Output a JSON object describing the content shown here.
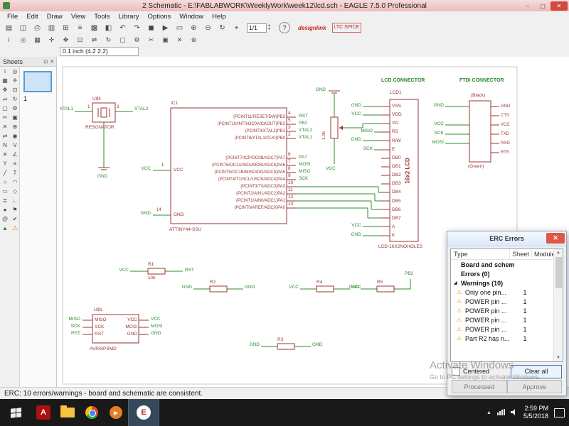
{
  "window": {
    "title": "2 Schematic - E:\\FABLABWORK\\WeeklyWork\\week12\\lcd.sch - EAGLE 7.5.0 Professional",
    "min_glyph": "–",
    "max_glyph": "▢",
    "close_glyph": "✕"
  },
  "menu": {
    "items": [
      "File",
      "Edit",
      "Draw",
      "View",
      "Tools",
      "Library",
      "Options",
      "Window",
      "Help"
    ]
  },
  "toolbar": {
    "zoom": "1/1",
    "coord": "0.1 inch (4.2 2.2)",
    "help": "?",
    "designlink": "designlink",
    "ltspice": "LTC SPICE",
    "row1": [
      {
        "name": "open-folder",
        "glyph": "▤"
      },
      {
        "name": "save",
        "glyph": "◫"
      },
      {
        "name": "print",
        "glyph": "⎙"
      },
      {
        "name": "export-image",
        "glyph": "▥"
      },
      {
        "name": "switch-to-board",
        "glyph": "⊞"
      },
      {
        "name": "use-library",
        "glyph": "≡"
      },
      {
        "name": "grid",
        "glyph": "▩"
      },
      {
        "name": "layer-settings",
        "glyph": "◧"
      },
      {
        "name": "undo",
        "glyph": "↶"
      },
      {
        "name": "redo",
        "glyph": "↷"
      },
      {
        "name": "stop-command",
        "glyph": "◼"
      },
      {
        "name": "run-script",
        "glyph": "▶"
      },
      {
        "name": "zoom-fit",
        "glyph": "▭"
      },
      {
        "name": "zoom-in",
        "glyph": "⊕"
      },
      {
        "name": "zoom-out",
        "glyph": "⊖"
      },
      {
        "name": "zoom-redraw",
        "glyph": "↻"
      },
      {
        "name": "zoom-select",
        "glyph": "⌖"
      }
    ],
    "row2": [
      {
        "name": "info",
        "glyph": "i"
      },
      {
        "name": "show",
        "glyph": "◎"
      },
      {
        "name": "display-layers",
        "glyph": "▦"
      },
      {
        "name": "mark",
        "glyph": "✛"
      },
      {
        "name": "move",
        "glyph": "✥"
      },
      {
        "name": "copy",
        "glyph": "⊡"
      },
      {
        "name": "mirror",
        "glyph": "⇌"
      },
      {
        "name": "rotate",
        "glyph": "↻"
      },
      {
        "name": "group",
        "glyph": "▢"
      },
      {
        "name": "change",
        "glyph": "⚙"
      },
      {
        "name": "cut",
        "glyph": "✂"
      },
      {
        "name": "paste",
        "glyph": "▣"
      },
      {
        "name": "delete",
        "glyph": "✕"
      },
      {
        "name": "add-part",
        "glyph": "⊕"
      }
    ]
  },
  "sheets": {
    "title": "Sheets",
    "selected": "1",
    "pin_icon": "⊡",
    "close_icon": "✕"
  },
  "palette": {
    "icons": [
      {
        "name": "info-tool",
        "glyph": "i"
      },
      {
        "name": "show-tool",
        "glyph": "◎"
      },
      {
        "name": "display-tool",
        "glyph": "▦"
      },
      {
        "name": "mark-tool",
        "glyph": "✛"
      },
      {
        "name": "move-tool",
        "glyph": "✥"
      },
      {
        "name": "copy-tool",
        "glyph": "⊡"
      },
      {
        "name": "mirror-tool",
        "glyph": "⇌"
      },
      {
        "name": "rotate-tool",
        "glyph": "↻"
      },
      {
        "name": "group-tool",
        "glyph": "▢"
      },
      {
        "name": "change-tool",
        "glyph": "⚙"
      },
      {
        "name": "cut-tool",
        "glyph": "✂"
      },
      {
        "name": "paste-tool",
        "glyph": "▣"
      },
      {
        "name": "delete-tool",
        "glyph": "✕"
      },
      {
        "name": "add-tool",
        "glyph": "⊕"
      },
      {
        "name": "pinswap-tool",
        "glyph": "⇄"
      },
      {
        "name": "replace-tool",
        "glyph": "◉"
      },
      {
        "name": "name-tool",
        "glyph": "N"
      },
      {
        "name": "value-tool",
        "glyph": "V"
      },
      {
        "name": "smash-tool",
        "glyph": "✳"
      },
      {
        "name": "miter-tool",
        "glyph": "∠"
      },
      {
        "name": "split-tool",
        "glyph": "Y"
      },
      {
        "name": "invoke-tool",
        "glyph": "≡"
      },
      {
        "name": "wire-tool",
        "glyph": "╱"
      },
      {
        "name": "text-tool",
        "glyph": "T"
      },
      {
        "name": "circle-tool",
        "glyph": "○"
      },
      {
        "name": "arc-tool",
        "glyph": "◠"
      },
      {
        "name": "rect-tool",
        "glyph": "▭"
      },
      {
        "name": "polygon-tool",
        "glyph": "◇"
      },
      {
        "name": "bus-tool",
        "glyph": "≣"
      },
      {
        "name": "net-tool",
        "glyph": "∟"
      },
      {
        "name": "junction-tool",
        "glyph": "●"
      },
      {
        "name": "label-tool",
        "glyph": "⚑"
      },
      {
        "name": "attribute-tool",
        "glyph": "@"
      },
      {
        "name": "erc-tool",
        "glyph": "✔"
      },
      {
        "name": "up-arrow-tool",
        "glyph": "▲"
      },
      {
        "name": "warning-indicator",
        "glyph": "⚠"
      }
    ]
  },
  "schematic": {
    "resonator": {
      "name": "U$4",
      "value": "RESONATOR",
      "left_net": "XTAL1",
      "right_net": "XTAL2",
      "left_pin": "1",
      "right_pin": "3",
      "gnd": "GND"
    },
    "ic1": {
      "name": "IC1",
      "value": "ATTINY44-SSU",
      "vcc_pin": {
        "num": "1",
        "label": "VCC",
        "net": "VCC"
      },
      "gnd_pin": {
        "num": "14",
        "label": "GND",
        "net": "GND"
      },
      "portb": [
        {
          "label": "(PCINT11/RESET/DW)PB3",
          "num": "4",
          "net": "RST"
        },
        {
          "label": "(PCINT10/INT0/OC0A/CKOUT)PB2",
          "num": "5",
          "net": "PB2"
        },
        {
          "label": "(PCINT9/XTAL2)PB1",
          "num": "3",
          "net": "XTAL2"
        },
        {
          "label": "(PCINT8/XTAL1/CLKI)PB0",
          "num": "2",
          "net": "XTAL1"
        }
      ],
      "porta": [
        {
          "label": "(PCINT7/ICP/OC0B/ADC7)PA7",
          "num": "6",
          "net": "PA7"
        },
        {
          "label": "(PCINT6/OC1A/SDA/MOSI/ADC6)PA6",
          "num": "7",
          "net": "MOSI"
        },
        {
          "label": "(PCINT5/OC1B/MISO/DO/ADC5)PA5",
          "num": "8",
          "net": "MISO"
        },
        {
          "label": "(PCINT4/T1/SCL/USCK/ADC4)PA4",
          "num": "9",
          "net": "SCK"
        },
        {
          "label": "(PCINT3/T0/ADC3)PA3",
          "num": "10",
          "net": ""
        },
        {
          "label": "(PCINT2/AIN1/ADC2)PA2",
          "num": "11",
          "net": ""
        },
        {
          "label": "(PCINT1/AIN0/ADC1)PA1",
          "num": "12",
          "net": ""
        },
        {
          "label": "(PCINT0/AREF/ADC0)PA0",
          "num": "13",
          "net": ""
        }
      ]
    },
    "pot": {
      "value": "1.0k",
      "top_net": "GND",
      "bottom_net": "VCC"
    },
    "lcd": {
      "header": "LCD CONNECTOR",
      "name": "LCD1",
      "display": "16x2 LCD",
      "value": "LCD-16X2NOHOLES",
      "pins": [
        "VSS",
        "VDD",
        "VO",
        "RS",
        "R/W",
        "E",
        "DB0",
        "DB1",
        "DB2",
        "DB3",
        "DB4",
        "DB5",
        "DB6",
        "DB7",
        "A",
        "K"
      ],
      "nets": {
        "vss": "GND",
        "vdd": "VCC",
        "rs": "MISO",
        "rw": "GND",
        "e": "SCK",
        "a": "VCC",
        "k": "GND"
      }
    },
    "ftdi": {
      "header": "FTDI CONNECTOR",
      "top_note": "(Black)",
      "bottom_note": "(Green)",
      "pins": [
        "GND",
        "CTS",
        "VCC",
        "TXD",
        "RXD",
        "RTS"
      ],
      "nets": [
        "GND",
        "VCC",
        "SCK",
        "MOSI"
      ]
    },
    "isp": {
      "name": "U$1",
      "value": "AVRISPSMD",
      "left_pins": [
        "MISO",
        "SCK",
        "RST"
      ],
      "right_pins": [
        "VCC",
        "MOSI",
        "GND"
      ],
      "left_nets": [
        "MISO",
        "SCK",
        "RST"
      ],
      "right_nets": [
        "VCC",
        "MOSI",
        "GND"
      ]
    },
    "resistors": [
      {
        "name": "R1",
        "value": "10k",
        "left": "VCC",
        "right": "RST"
      },
      {
        "name": "R2",
        "value": "",
        "left": "GND",
        "right": "GND"
      },
      {
        "name": "R3",
        "value": "",
        "left": "GND",
        "right": "GND"
      },
      {
        "name": "R4",
        "value": "",
        "left": "VCC",
        "right": "VCC"
      },
      {
        "name": "R5",
        "value": "",
        "left": "GND",
        "right": "PB2"
      }
    ]
  },
  "erc": {
    "title": "ERC Errors",
    "warning_glyph": "⚠",
    "expander_glyph": "◢",
    "columns": [
      "Type",
      "Sheet",
      "Module"
    ],
    "tree": [
      {
        "label": "Board and schemati..."
      },
      {
        "label": "Errors (0)"
      },
      {
        "label": "Warnings (10)"
      }
    ],
    "warnings": [
      {
        "text": "Only one pin...",
        "sheet": "1"
      },
      {
        "text": "POWER pin ...",
        "sheet": "1"
      },
      {
        "text": "POWER pin ...",
        "sheet": "1"
      },
      {
        "text": "POWER pin ...",
        "sheet": "1"
      },
      {
        "text": "POWER pin ...",
        "sheet": "1"
      },
      {
        "text": "Part R2 has n...",
        "sheet": "1"
      }
    ],
    "centered_label": "Centered",
    "buttons": {
      "clear_all": "Clear all",
      "processed": "Processed",
      "approve": "Approve"
    }
  },
  "status": {
    "text": "ERC: 10 errors/warnings - board and schematic are consistent."
  },
  "watermark": {
    "line1": "Activate Windows",
    "line2": "Go to PC settings to activate Windows."
  },
  "taskbar": {
    "time": "2:59 PM",
    "date": "5/5/2018"
  }
}
